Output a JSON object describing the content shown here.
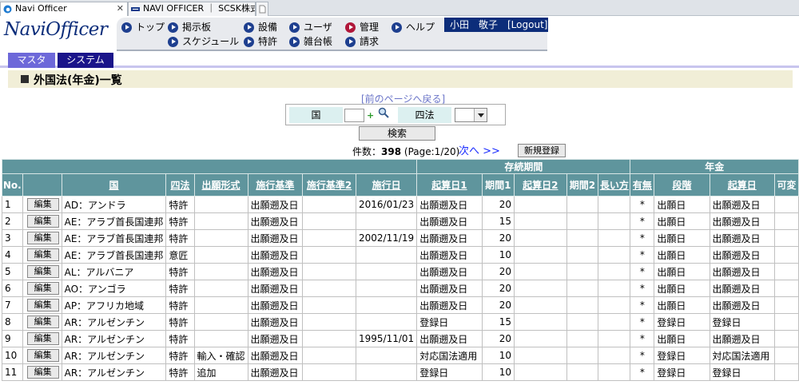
{
  "browser": {
    "tabs": [
      {
        "label": "Navi Officer"
      },
      {
        "label": "NAVI OFFICER ｜ SCSK株式会社"
      },
      {
        "label": ""
      }
    ]
  },
  "header": {
    "logo": "NaviOfficer",
    "nav": [
      {
        "label": "トップ"
      },
      {
        "label": "掲示板"
      },
      {
        "label": "設備"
      },
      {
        "label": "ユーザ"
      },
      {
        "label": "管理"
      },
      {
        "label": "ヘルプ"
      },
      {
        "label": "スケジュール"
      },
      {
        "label": "特許"
      },
      {
        "label": "雑台帳"
      },
      {
        "label": "請求"
      }
    ],
    "user": "小田　敬子　[Logout]"
  },
  "menu_tabs": [
    {
      "label": "マスタ"
    },
    {
      "label": "システム"
    }
  ],
  "page_title": "外国法(年金)一覧",
  "search": {
    "prev_link": "[前のページへ戻る]",
    "country_label": "国",
    "country_value": "",
    "shiho_label": "四法",
    "shiho_selected": "",
    "search_button": "検索"
  },
  "results": {
    "count_label": "件数：",
    "count_value": "398",
    "page_info": "(Page:1/20)",
    "next_link": "次へ >>",
    "new_button": "新規登録"
  },
  "table": {
    "group_headers": {
      "sonzoku": "存続期間",
      "nenkin": "年金"
    },
    "columns": {
      "no": "No.",
      "kuni": "国",
      "shiho": "四法",
      "shutsugan": "出願形式",
      "kijun": "施行基準",
      "kijun2": "施行基準2",
      "seko_date": "施行日",
      "kisan1": "起算日1",
      "kikan1": "期間1",
      "kisan2": "起算日2",
      "kikan2": "期間2",
      "nagai": "長い方",
      "umu": "有無",
      "dankai": "段階",
      "nenkin_kisan": "起算日",
      "kahen": "可変"
    },
    "edit_label": "編集",
    "rows": [
      {
        "no": "1",
        "kuni": "AD：アンドラ",
        "shiho": "特許",
        "shutsugan": "",
        "kijun": "出願遡及日",
        "kijun2": "",
        "seko_date": "2016/01/23",
        "kisan1": "出願遡及日",
        "kikan1": "20",
        "kisan2": "",
        "kikan2": "",
        "nagai": "",
        "umu": "*",
        "dankai": "出願日",
        "nenkin_kisan": "出願遡及日",
        "kahen": ""
      },
      {
        "no": "2",
        "kuni": "AE：アラブ首長国連邦",
        "shiho": "特許",
        "shutsugan": "",
        "kijun": "出願遡及日",
        "kijun2": "",
        "seko_date": "",
        "kisan1": "出願遡及日",
        "kikan1": "15",
        "kisan2": "",
        "kikan2": "",
        "nagai": "",
        "umu": "*",
        "dankai": "出願日",
        "nenkin_kisan": "出願遡及日",
        "kahen": ""
      },
      {
        "no": "3",
        "kuni": "AE：アラブ首長国連邦",
        "shiho": "特許",
        "shutsugan": "",
        "kijun": "出願遡及日",
        "kijun2": "",
        "seko_date": "2002/11/19",
        "kisan1": "出願遡及日",
        "kikan1": "20",
        "kisan2": "",
        "kikan2": "",
        "nagai": "",
        "umu": "*",
        "dankai": "出願日",
        "nenkin_kisan": "出願遡及日",
        "kahen": ""
      },
      {
        "no": "4",
        "kuni": "AE：アラブ首長国連邦",
        "shiho": "意匠",
        "shutsugan": "",
        "kijun": "出願遡及日",
        "kijun2": "",
        "seko_date": "",
        "kisan1": "出願遡及日",
        "kikan1": "10",
        "kisan2": "",
        "kikan2": "",
        "nagai": "",
        "umu": "*",
        "dankai": "出願日",
        "nenkin_kisan": "出願遡及日",
        "kahen": ""
      },
      {
        "no": "5",
        "kuni": "AL：アルバニア",
        "shiho": "特許",
        "shutsugan": "",
        "kijun": "出願遡及日",
        "kijun2": "",
        "seko_date": "",
        "kisan1": "出願遡及日",
        "kikan1": "20",
        "kisan2": "",
        "kikan2": "",
        "nagai": "",
        "umu": "*",
        "dankai": "出願日",
        "nenkin_kisan": "出願遡及日",
        "kahen": ""
      },
      {
        "no": "6",
        "kuni": "AO：アンゴラ",
        "shiho": "特許",
        "shutsugan": "",
        "kijun": "出願遡及日",
        "kijun2": "",
        "seko_date": "",
        "kisan1": "出願遡及日",
        "kikan1": "20",
        "kisan2": "",
        "kikan2": "",
        "nagai": "",
        "umu": "*",
        "dankai": "出願日",
        "nenkin_kisan": "出願遡及日",
        "kahen": ""
      },
      {
        "no": "7",
        "kuni": "AP：アフリカ地域",
        "shiho": "特許",
        "shutsugan": "",
        "kijun": "出願遡及日",
        "kijun2": "",
        "seko_date": "",
        "kisan1": "出願遡及日",
        "kikan1": "20",
        "kisan2": "",
        "kikan2": "",
        "nagai": "",
        "umu": "*",
        "dankai": "出願日",
        "nenkin_kisan": "出願遡及日",
        "kahen": ""
      },
      {
        "no": "8",
        "kuni": "AR：アルゼンチン",
        "shiho": "特許",
        "shutsugan": "",
        "kijun": "出願遡及日",
        "kijun2": "",
        "seko_date": "",
        "kisan1": "登録日",
        "kikan1": "15",
        "kisan2": "",
        "kikan2": "",
        "nagai": "",
        "umu": "*",
        "dankai": "登録日",
        "nenkin_kisan": "登録日",
        "kahen": ""
      },
      {
        "no": "9",
        "kuni": "AR：アルゼンチン",
        "shiho": "特許",
        "shutsugan": "",
        "kijun": "出願遡及日",
        "kijun2": "",
        "seko_date": "1995/11/01",
        "kisan1": "出願遡及日",
        "kikan1": "20",
        "kisan2": "",
        "kikan2": "",
        "nagai": "",
        "umu": "*",
        "dankai": "出願日",
        "nenkin_kisan": "出願遡及日",
        "kahen": ""
      },
      {
        "no": "10",
        "kuni": "AR：アルゼンチン",
        "shiho": "特許",
        "shutsugan": "輸入・確認",
        "kijun": "出願遡及日",
        "kijun2": "",
        "seko_date": "",
        "kisan1": "対応国法適用",
        "kikan1": "10",
        "kisan2": "",
        "kikan2": "",
        "nagai": "",
        "umu": "*",
        "dankai": "登録日",
        "nenkin_kisan": "対応国法適用",
        "kahen": ""
      },
      {
        "no": "11",
        "kuni": "AR：アルゼンチン",
        "shiho": "特許",
        "shutsugan": "追加",
        "kijun": "出願遡及日",
        "kijun2": "",
        "seko_date": "",
        "kisan1": "登録日",
        "kikan1": "10",
        "kisan2": "",
        "kikan2": "",
        "nagai": "",
        "umu": "*",
        "dankai": "登録日",
        "nenkin_kisan": "登録日",
        "kahen": ""
      }
    ]
  },
  "colors": {
    "header_teal": "#5f959d",
    "navy": "#0c2d7a",
    "title_bg": "#f1eed7",
    "tab_light": "#6d68d9",
    "tab_dark": "#1a148a"
  }
}
